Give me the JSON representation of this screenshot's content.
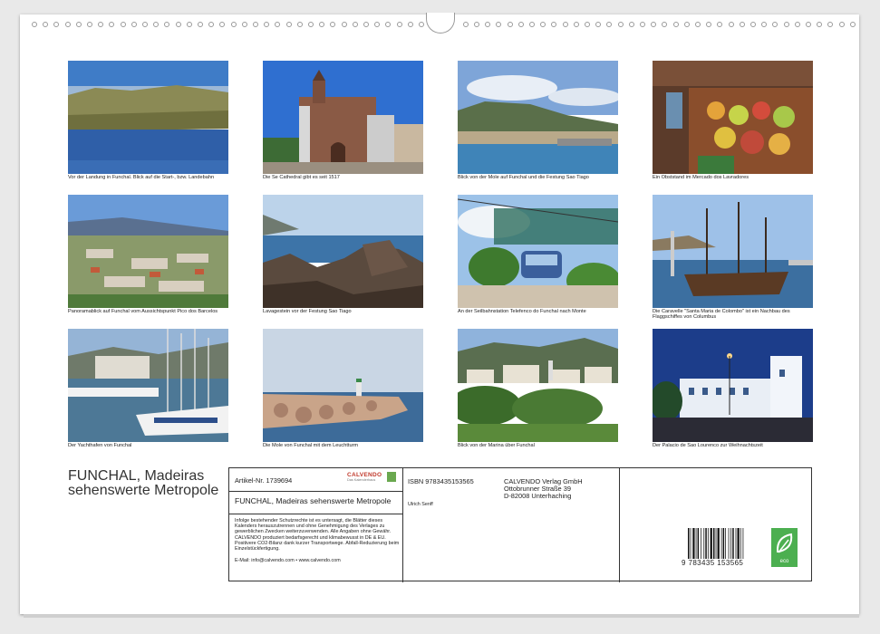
{
  "captions": [
    "Vor der Landung in Funchal. Blick auf die Start-, bzw. Landebahn",
    "Die Se Cathedral gibt es seit 1517",
    "Blick von der Mole auf Funchal und die Festung Sao Tiago",
    "Ein Obststand im Mercado dos Lavradores",
    "Panoramablick auf Funchal vom Aussichtspunkt Pico dos Barcelos",
    "Lavagestein vor der Festung Sao Tiago",
    "An der Seilbahnstation Telefenco do Funchal nach Monte",
    "Die Caravelle \"Santa Maria de Colombo\" ist ein Nachbau des Flaggschiffes von Columbus",
    "Der Yachthafen von Funchal",
    "Die Mole von Funchal mit dem Leuchtturm",
    "Blick von der Marina über Funchal",
    "Der Palacio de Sao Lourenco zur Weihnachtszeit"
  ],
  "title": "FUNCHAL, Madeiras sehenswerte Metropole",
  "info": {
    "article": "Artikel-Nr. 1739694",
    "logo": "CALVENDO",
    "logo_sub": "Das Kalenderhaus",
    "product_title": "FUNCHAL, Madeiras sehenswerte Metropole",
    "isbn": "ISBN 9783435153565",
    "author": "Ulrich Senff",
    "publisher_1": "CALVENDO Verlag GmbH",
    "publisher_2": "Ottobrunner Straße 39",
    "publisher_3": "D-82008 Unterhaching",
    "legal": "Infolge bestehender Schutzrechte ist es untersagt, die Blätter dieses Kalenders herauszutrennen und ohne Genehmigung des Verlages zu gewerblichen Zwecken weiterzuverwenden. Alle Angaben ohne Gewähr. CALVENDO produziert bedarfsgerecht und klimabewusst in DE & EU. Positivere CO2-Bilanz dank kurzer Transportwege. Abfall-Reduzierung beim Einzelstückfertigung.",
    "contact": "E-Mail: info@calvendo.com • www.calvendo.com",
    "barcode_digits": "9 783435 153565",
    "eco": "eco"
  },
  "colors": {
    "frame": "#333333",
    "logo_green": "#6aa84f",
    "eco_green": "#4caf50"
  }
}
